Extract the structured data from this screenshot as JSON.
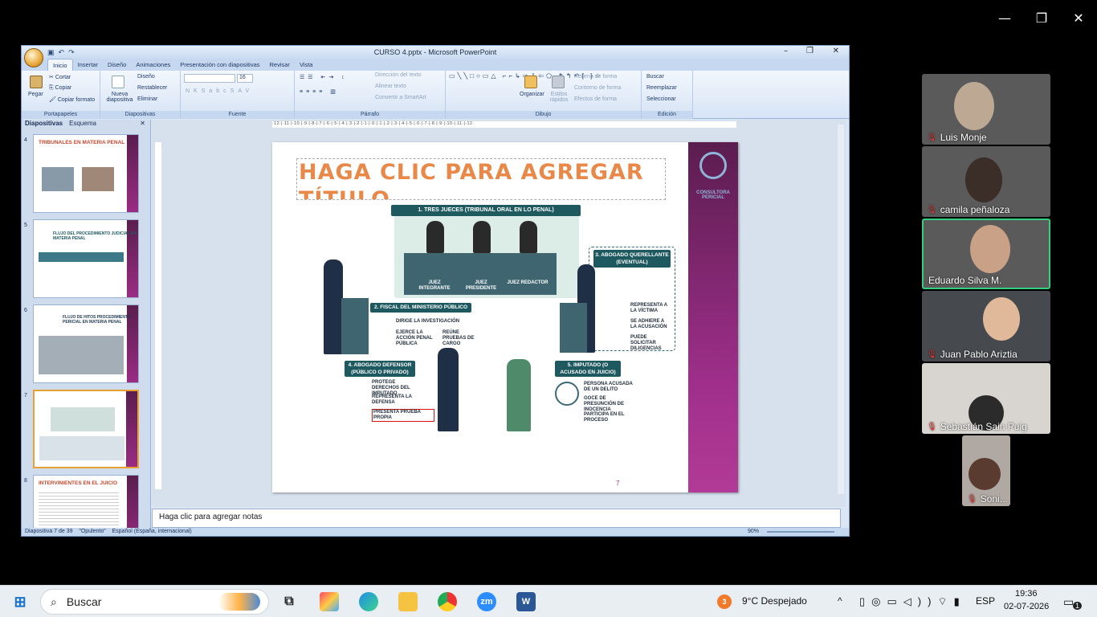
{
  "window_controls": {
    "minimize": "—",
    "maximize": "❐",
    "close": "✕"
  },
  "ppt": {
    "title": "CURSO 4.pptx - Microsoft PowerPoint",
    "tabs": [
      "Inicio",
      "Insertar",
      "Diseño",
      "Animaciones",
      "Presentación con diapositivas",
      "Revisar",
      "Vista"
    ],
    "ribbon": {
      "portapapeles": {
        "paste": "Pegar",
        "cut": "Cortar",
        "copy": "Copiar",
        "format": "Copiar formato",
        "group": "Portapapeles"
      },
      "diapositivas": {
        "new": "Nueva diapositiva",
        "design": "Diseño",
        "reset": "Restablecer",
        "delete": "Eliminar",
        "group": "Diapositivas"
      },
      "fuente": {
        "size": "16",
        "group": "Fuente"
      },
      "parrafo": {
        "dir": "Dirección del texto",
        "align": "Alinear texto",
        "smartart": "Convertir a SmartArt",
        "group": "Párrafo"
      },
      "dibujo": {
        "organize": "Organizar",
        "styles": "Estilos rápidos",
        "fill": "Relleno de forma",
        "outline": "Contorno de forma",
        "effects": "Efectos de forma",
        "group": "Dibujo"
      },
      "edicion": {
        "find": "Buscar",
        "replace": "Reemplazar",
        "select": "Seleccionar",
        "group": "Edición"
      }
    },
    "panel_tabs": {
      "slides": "Diapositivas",
      "outline": "Esquema"
    },
    "thumbnails": [
      {
        "num": "4",
        "title": "TRIBUNALES EN MATERIA PENAL"
      },
      {
        "num": "5",
        "title": "FLUJO DEL PROCEDIMIENTO JUDICIAL EN MATERIA PENAL"
      },
      {
        "num": "6",
        "title": "FLUJO DE HITOS PROCEDIMIENTO PERICIAL EN MATERIA PENAL"
      },
      {
        "num": "7",
        "title": ""
      },
      {
        "num": "8",
        "title": "INTERVINIENTES EN EL JUICIO"
      }
    ],
    "slide": {
      "title_placeholder": "HAGA CLIC PARA AGREGAR TÍTULO",
      "brand": "CONSULTORA PERICIAL",
      "page_number": "7",
      "infographic": {
        "judges_banner": "1. TRES JUECES (TRIBUNAL ORAL EN LO PENAL)",
        "judge_labels": [
          "JUEZ INTEGRANTE",
          "JUEZ PRESIDENTE",
          "JUEZ REDACTOR"
        ],
        "fiscal": {
          "title": "2. FISCAL DEL MINISTERIO PÚBLICO",
          "items": [
            "DIRIGE LA INVESTIGACIÓN",
            "EJERCE LA ACCIÓN PENAL PÚBLICA",
            "REÚNE PRUEBAS DE CARGO"
          ]
        },
        "querellante": {
          "title": "3. ABOGADO QUERELLANTE (EVENTUAL)",
          "items": [
            "REPRESENTA A LA VÍCTIMA",
            "SE ADHIERE A LA ACUSACIÓN",
            "PUEDE SOLICITAR DILIGENCIAS"
          ]
        },
        "defensor": {
          "title": "4. ABOGADO DEFENSOR (PÚBLICO O PRIVADO)",
          "items": [
            "PROTEGE DERECHOS DEL IMPUTADO",
            "REPRESENTA LA DEFENSA",
            "PRESENTA PRUEBA PROPIA"
          ]
        },
        "imputado": {
          "title": "5. IMPUTADO (O ACUSADO EN JUICIO)",
          "items": [
            "PERSONA ACUSADA DE UN DELITO",
            "GOCE DE PRESUNCIÓN DE INOCENCIA",
            "PARTICIPA EN EL PROCESO"
          ]
        }
      }
    },
    "notes": "Haga clic para agregar notas",
    "status": {
      "slide": "Diapositiva 7 de 39",
      "theme": "\"Opulento\"",
      "lang": "Español (España, internacional)",
      "zoom": "90%"
    }
  },
  "participants": [
    {
      "name": "Luis Monje",
      "color": "#7c7c84"
    },
    {
      "name": "camila peñaloza",
      "color": "#8a8a8c"
    },
    {
      "name": "Eduardo Silva M.",
      "color": "#6b6d72"
    },
    {
      "name": "Juan Pablo Ariztia",
      "color": "#4f5257"
    },
    {
      "name": "Sebastián Sain Puig",
      "color": "#b9b6b2"
    },
    {
      "name": "Soni...",
      "color": "#a09a96"
    }
  ],
  "taskbar": {
    "search": "Buscar",
    "weather": "9°C  Despejado",
    "weather_badge": "3",
    "lang": "ESP",
    "time": "19:36",
    "date": "02-07-2026",
    "notif": "1",
    "zoom_label": "zm"
  }
}
